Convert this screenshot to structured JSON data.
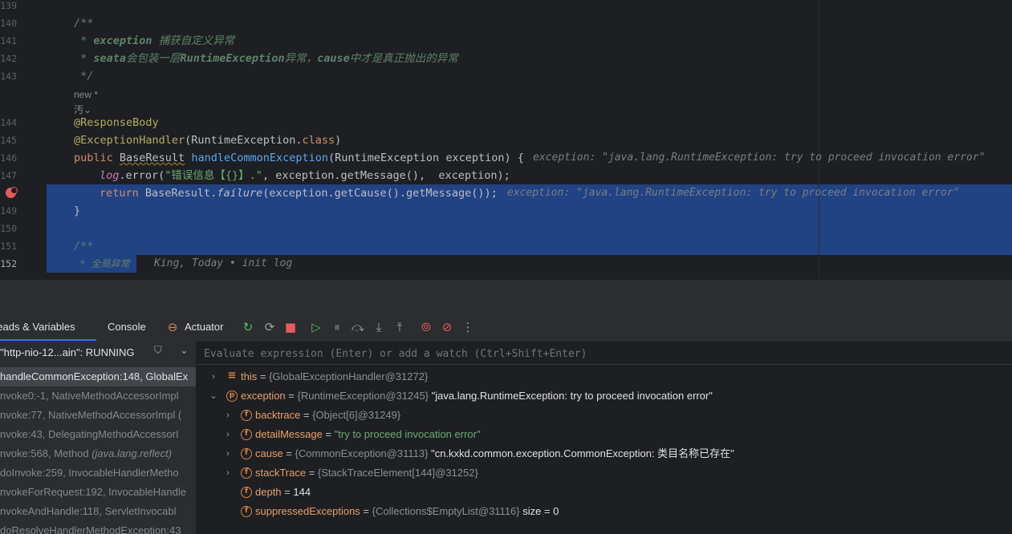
{
  "editor": {
    "line_numbers": [
      "139",
      "140",
      "141",
      "142",
      "143",
      "144",
      "145",
      "146",
      "147",
      "148",
      "149",
      "150",
      "151",
      "152"
    ],
    "lines": {
      "l140": "/**",
      "l141_a": " * ",
      "l141_b": "exception",
      "l141_c": " 捕获自定义异常",
      "l142_a": " * ",
      "l142_b": "seata",
      "l142_c": "会包装一层",
      "l142_d": "RuntimeException",
      "l142_e": "异常，",
      "l142_f": "cause",
      "l142_g": "中才是真正抛出的异常",
      "l143": " */",
      "hint_new": "new *",
      "hint_icon": "汚⌄",
      "l144": "@ResponseBody",
      "l145_a": "@ExceptionHandler",
      "l145_b": "(RuntimeException.",
      "l145_c": "class",
      "l145_d": ")",
      "l146_a": "public ",
      "l146_b": "BaseResult",
      "l146_c": " ",
      "l146_d": "handleCommonException",
      "l146_e": "(RuntimeException exception) {",
      "l146_inline": "exception: \"java.lang.RuntimeException: try to proceed invocation error\"",
      "l147_a": "log",
      "l147_b": ".error(",
      "l147_c": "\"错误信息【{}】.\"",
      "l147_d": ", exception.getMessage(),  exception);",
      "l148_a": "return ",
      "l148_b": "BaseResult.",
      "l148_c": "failure",
      "l148_d": "(exception.getCause().getMessage());",
      "l148_inline": "exception: \"java.lang.RuntimeException: try to proceed invocation error\"",
      "l149": "}",
      "l151": "/**",
      "l152_a": " * 全局异常",
      "l152_inline": "King, Today • init log"
    }
  },
  "debug": {
    "tabs": [
      "reads & Variables",
      "Console",
      "Actuator"
    ],
    "thread_label": "\"http-nio-12...ain\": RUNNING",
    "eval_placeholder": "Evaluate expression (Enter) or add a watch (Ctrl+Shift+Enter)",
    "frames": [
      {
        "method": "handleCommonException:148, GlobalEx",
        "cls": "",
        "active": true
      },
      {
        "method": "nvoke0:-1, NativeMethodAccessorImpl",
        "cls": ""
      },
      {
        "method": "nvoke:77, NativeMethodAccessorImpl (",
        "cls": ""
      },
      {
        "method": "nvoke:43, DelegatingMethodAccessorI",
        "cls": ""
      },
      {
        "method": "nvoke:568, Method ",
        "cls": "(java.lang.reflect)"
      },
      {
        "method": "doInvoke:259, InvocableHandlerMetho",
        "cls": ""
      },
      {
        "method": "nvokeForRequest:192, InvocableHandle",
        "cls": ""
      },
      {
        "method": "nvokeAndHandle:118, ServletInvocabl",
        "cls": ""
      },
      {
        "method": "doResolveHandlerMethodException:43",
        "cls": ""
      }
    ],
    "variables": [
      {
        "name": "this",
        "type": "{GlobalExceptionHandler@31272}",
        "value": "",
        "icon": "≡",
        "expand": "›",
        "level": 0
      },
      {
        "name": "exception",
        "type": "{RuntimeException@31245}",
        "value": "\"java.lang.RuntimeException: try to proceed invocation error\"",
        "icon": "p",
        "expand": "⌄",
        "level": 0
      },
      {
        "name": "backtrace",
        "type": "{Object[6]@31249}",
        "value": "",
        "icon": "f",
        "expand": "›",
        "level": 1
      },
      {
        "name": "detailMessage",
        "type": "",
        "value": "\"try to proceed invocation error\"",
        "icon": "f",
        "expand": "›",
        "level": 1,
        "string": true
      },
      {
        "name": "cause",
        "type": "{CommonException@31113}",
        "value": "\"cn.kxkd.common.exception.CommonException: 类目名称已存在\"",
        "icon": "f",
        "expand": "›",
        "level": 1
      },
      {
        "name": "stackTrace",
        "type": "{StackTraceElement[144]@31252}",
        "value": "",
        "icon": "f",
        "expand": "›",
        "level": 1
      },
      {
        "name": "depth",
        "type": "",
        "value": "144",
        "icon": "f",
        "expand": "",
        "level": 1
      },
      {
        "name": "suppressedExceptions",
        "type": "{Collections$EmptyList@31116}",
        "value": " size = 0",
        "icon": "f",
        "expand": "",
        "level": 1
      }
    ]
  },
  "colors": {
    "selection": "#214283",
    "accent": "#3574f0",
    "breakpoint": "#e55c5c"
  }
}
